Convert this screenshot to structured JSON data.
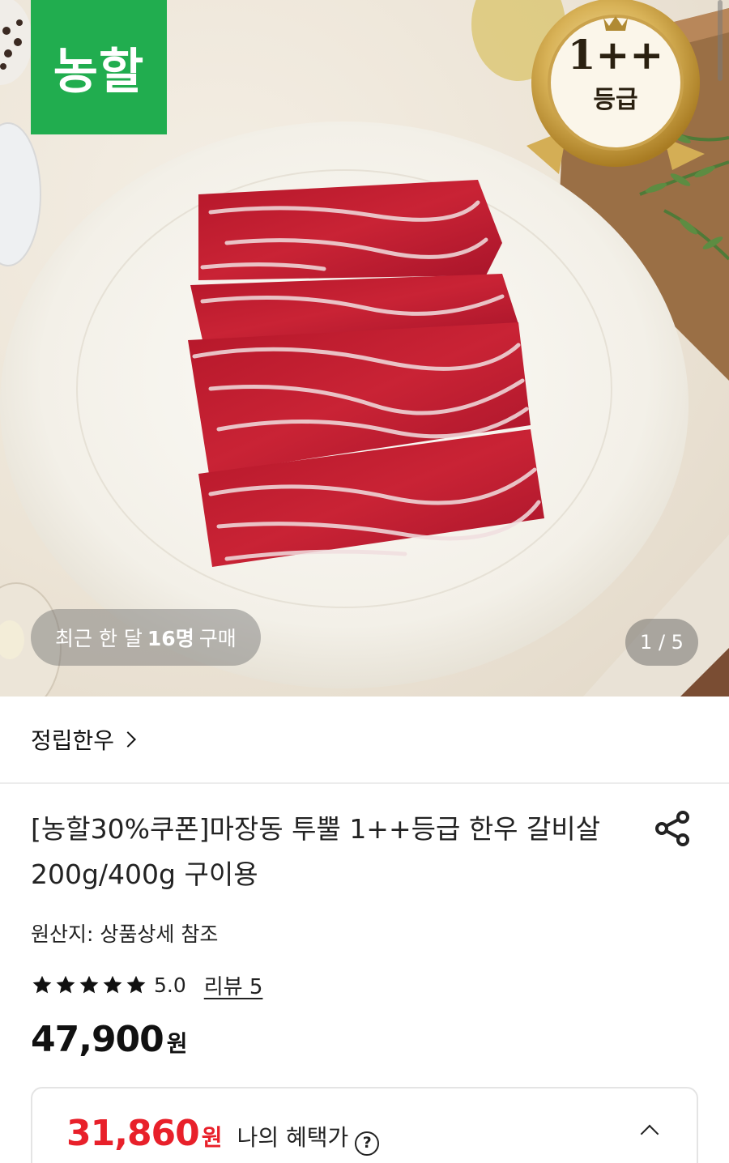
{
  "hero": {
    "brand_logo": "농할",
    "grade_badge": {
      "grade": "1++",
      "label": "등급"
    },
    "purchase_badge": {
      "prefix": "최근 한 달",
      "count": "16명",
      "suffix": "구매"
    },
    "pager": "1 / 5"
  },
  "store": {
    "name": "정립한우"
  },
  "product": {
    "title": "[농할30%쿠폰]마장동 투뿔 1++등급 한우 갈비살 200g/400g 구이용",
    "origin": "원산지: 상품상세 참조",
    "rating": {
      "stars": 5,
      "value": "5.0",
      "review_link": "리뷰 5"
    },
    "price": {
      "amount": "47,900",
      "unit": "원"
    }
  },
  "benefit": {
    "amount": "31,860",
    "unit": "원",
    "label": "나의 혜택가",
    "help": "?"
  },
  "icons": {
    "share": "share-icon",
    "help": "question-circle-icon",
    "collapse": "chevron-up-icon",
    "store_chevron": "chevron-right-icon",
    "star": "star-icon"
  },
  "colors": {
    "brand_green": "#21ad4f",
    "benefit_red": "#e8202a",
    "gold": "#c9a23a"
  }
}
